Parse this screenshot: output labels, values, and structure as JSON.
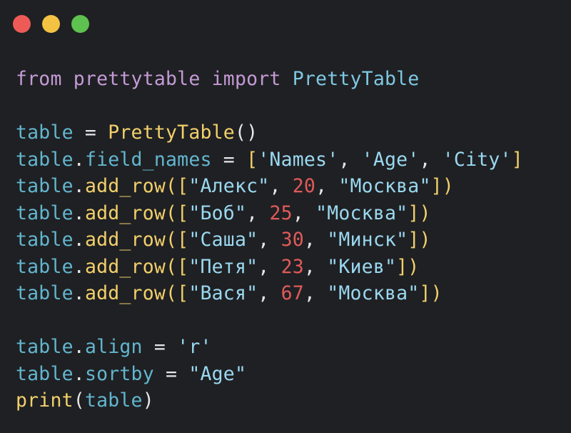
{
  "window": {
    "buttons": {
      "close_color": "#ee5b57",
      "minimize_color": "#f4c243",
      "maximize_color": "#5dc24f"
    }
  },
  "code": {
    "lines": [
      [
        {
          "t": "from",
          "c": "kw"
        },
        {
          "t": " ",
          "c": "op"
        },
        {
          "t": "prettytable",
          "c": "mod"
        },
        {
          "t": " ",
          "c": "op"
        },
        {
          "t": "import",
          "c": "kw"
        },
        {
          "t": " ",
          "c": "op"
        },
        {
          "t": "PrettyTable",
          "c": "cls"
        }
      ],
      [],
      [
        {
          "t": "table",
          "c": "var"
        },
        {
          "t": " = ",
          "c": "op"
        },
        {
          "t": "PrettyTable",
          "c": "fn"
        },
        {
          "t": "()",
          "c": "punc"
        }
      ],
      [
        {
          "t": "table",
          "c": "var"
        },
        {
          "t": ".",
          "c": "op"
        },
        {
          "t": "field_names",
          "c": "var"
        },
        {
          "t": " = ",
          "c": "op"
        },
        {
          "t": "[",
          "c": "brk"
        },
        {
          "t": "'Names'",
          "c": "str"
        },
        {
          "t": ", ",
          "c": "op"
        },
        {
          "t": "'Age'",
          "c": "str"
        },
        {
          "t": ", ",
          "c": "op"
        },
        {
          "t": "'City'",
          "c": "str"
        },
        {
          "t": "]",
          "c": "brk"
        }
      ],
      [
        {
          "t": "table",
          "c": "var"
        },
        {
          "t": ".",
          "c": "op"
        },
        {
          "t": "add_row",
          "c": "fn"
        },
        {
          "t": "([",
          "c": "brk"
        },
        {
          "t": "\"Алекс\"",
          "c": "str"
        },
        {
          "t": ", ",
          "c": "op"
        },
        {
          "t": "20",
          "c": "num"
        },
        {
          "t": ", ",
          "c": "op"
        },
        {
          "t": "\"Москва\"",
          "c": "str"
        },
        {
          "t": "])",
          "c": "brk"
        }
      ],
      [
        {
          "t": "table",
          "c": "var"
        },
        {
          "t": ".",
          "c": "op"
        },
        {
          "t": "add_row",
          "c": "fn"
        },
        {
          "t": "([",
          "c": "brk"
        },
        {
          "t": "\"Боб\"",
          "c": "str"
        },
        {
          "t": ", ",
          "c": "op"
        },
        {
          "t": "25",
          "c": "num"
        },
        {
          "t": ", ",
          "c": "op"
        },
        {
          "t": "\"Москва\"",
          "c": "str"
        },
        {
          "t": "])",
          "c": "brk"
        }
      ],
      [
        {
          "t": "table",
          "c": "var"
        },
        {
          "t": ".",
          "c": "op"
        },
        {
          "t": "add_row",
          "c": "fn"
        },
        {
          "t": "([",
          "c": "brk"
        },
        {
          "t": "\"Саша\"",
          "c": "str"
        },
        {
          "t": ", ",
          "c": "op"
        },
        {
          "t": "30",
          "c": "num"
        },
        {
          "t": ", ",
          "c": "op"
        },
        {
          "t": "\"Минск\"",
          "c": "str"
        },
        {
          "t": "])",
          "c": "brk"
        }
      ],
      [
        {
          "t": "table",
          "c": "var"
        },
        {
          "t": ".",
          "c": "op"
        },
        {
          "t": "add_row",
          "c": "fn"
        },
        {
          "t": "([",
          "c": "brk"
        },
        {
          "t": "\"Петя\"",
          "c": "str"
        },
        {
          "t": ", ",
          "c": "op"
        },
        {
          "t": "23",
          "c": "num"
        },
        {
          "t": ", ",
          "c": "op"
        },
        {
          "t": "\"Киев\"",
          "c": "str"
        },
        {
          "t": "])",
          "c": "brk"
        }
      ],
      [
        {
          "t": "table",
          "c": "var"
        },
        {
          "t": ".",
          "c": "op"
        },
        {
          "t": "add_row",
          "c": "fn"
        },
        {
          "t": "([",
          "c": "brk"
        },
        {
          "t": "\"Вася\"",
          "c": "str"
        },
        {
          "t": ", ",
          "c": "op"
        },
        {
          "t": "67",
          "c": "num"
        },
        {
          "t": ", ",
          "c": "op"
        },
        {
          "t": "\"Москва\"",
          "c": "str"
        },
        {
          "t": "])",
          "c": "brk"
        }
      ],
      [],
      [
        {
          "t": "table",
          "c": "var"
        },
        {
          "t": ".",
          "c": "op"
        },
        {
          "t": "align",
          "c": "var"
        },
        {
          "t": " = ",
          "c": "op"
        },
        {
          "t": "'r'",
          "c": "str"
        }
      ],
      [
        {
          "t": "table",
          "c": "var"
        },
        {
          "t": ".",
          "c": "op"
        },
        {
          "t": "sortby",
          "c": "var"
        },
        {
          "t": " = ",
          "c": "op"
        },
        {
          "t": "\"Age\"",
          "c": "str"
        }
      ],
      [
        {
          "t": "print",
          "c": "fn"
        },
        {
          "t": "(",
          "c": "punc"
        },
        {
          "t": "table",
          "c": "var"
        },
        {
          "t": ")",
          "c": "punc"
        }
      ]
    ]
  }
}
